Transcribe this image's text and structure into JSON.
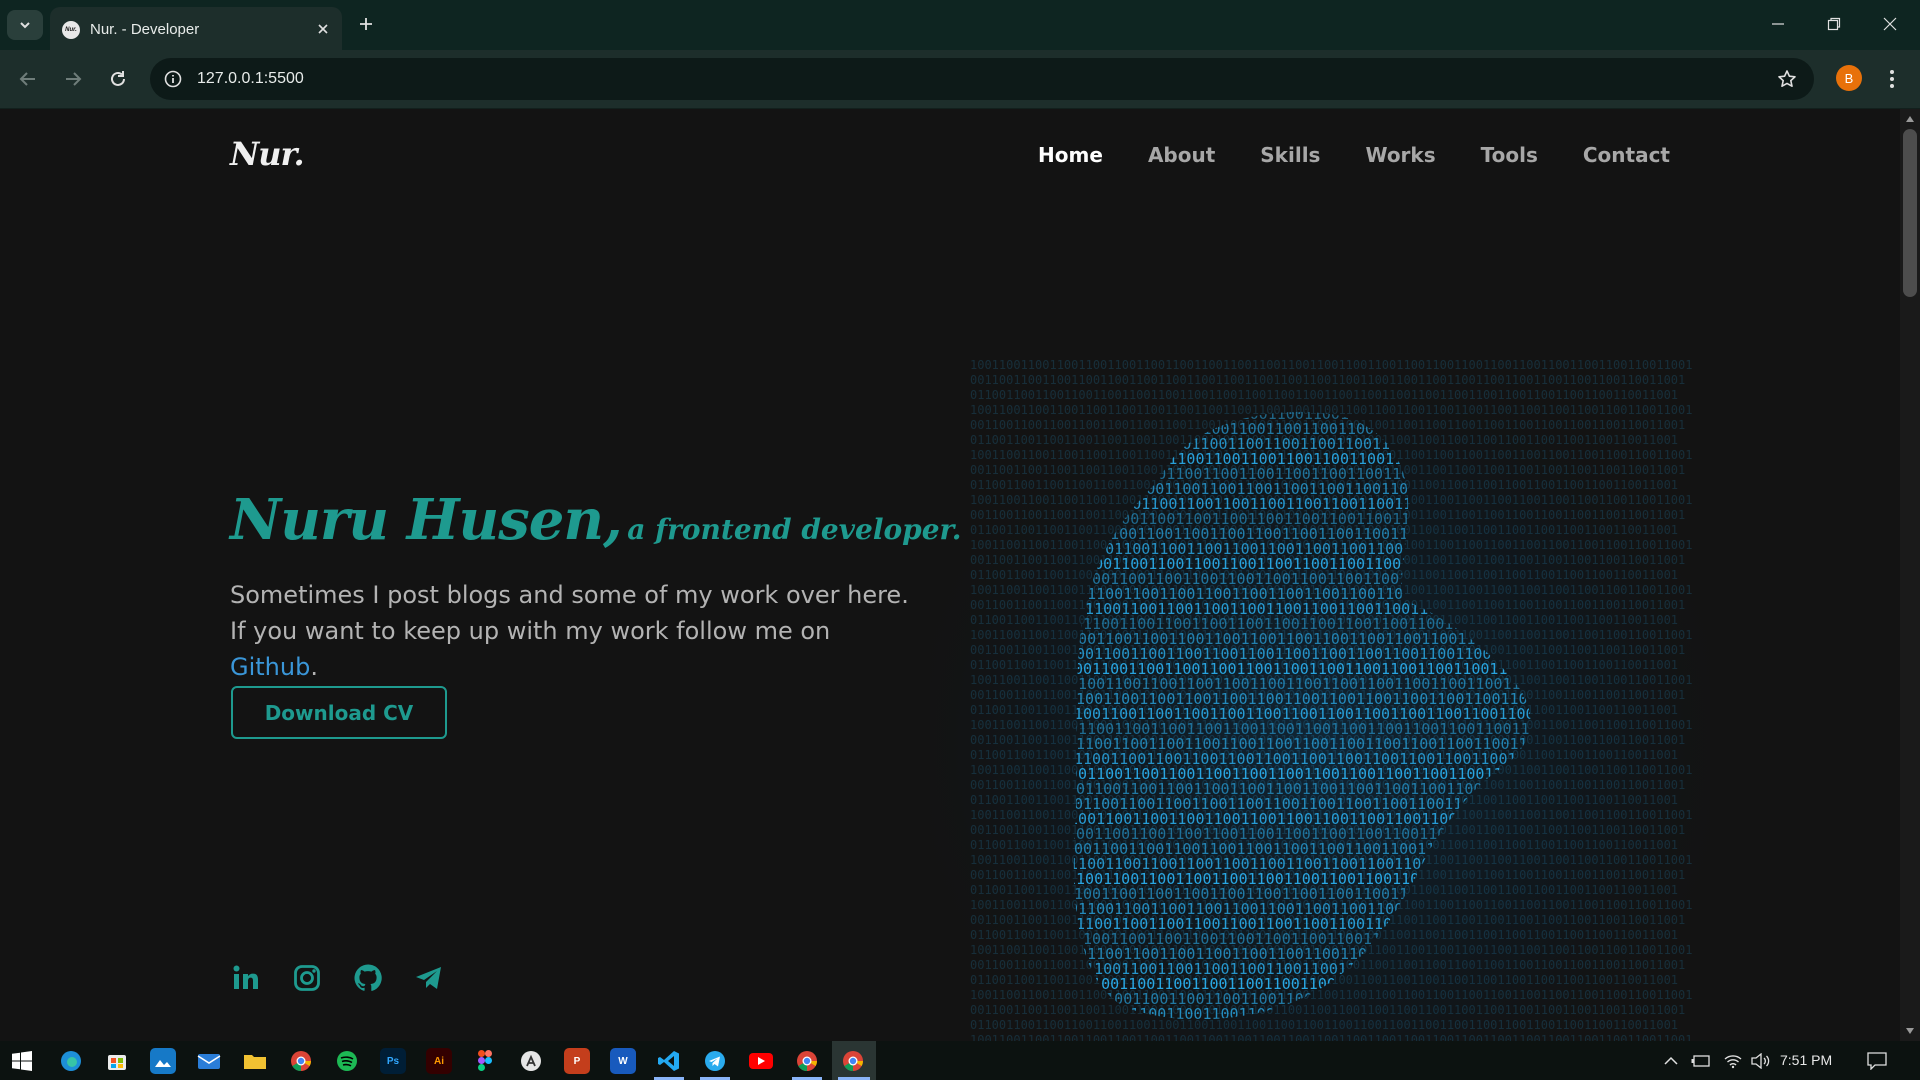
{
  "browser": {
    "tab_title": "Nur. - Developer",
    "tab_favicon_text": "Nur.",
    "url": "127.0.0.1:5500",
    "profile_initial": "B"
  },
  "site": {
    "logo": "Nur.",
    "nav": [
      {
        "label": "Home",
        "active": true
      },
      {
        "label": "About"
      },
      {
        "label": "Skills"
      },
      {
        "label": "Works"
      },
      {
        "label": "Tools"
      },
      {
        "label": "Contact"
      }
    ],
    "hero": {
      "name": "Nuru Husen,",
      "role": "a frontend developer.",
      "desc_before": "Sometimes I post blogs and some of my work over here. If you want to keep up with my work follow me on ",
      "desc_link": "Github",
      "desc_after": ".",
      "cv_button": "Download CV"
    },
    "socials": [
      "linkedin-icon",
      "instagram-icon",
      "github-icon",
      "telegram-icon"
    ],
    "binary_text": "10011001100110011001"
  },
  "taskbar": {
    "clock": "7:51 PM",
    "apps": [
      "edge",
      "store",
      "photos",
      "mail",
      "explorer",
      "chrome",
      "spotify",
      "Ps",
      "Ai",
      "figma",
      "appstore",
      "P",
      "W",
      "vscode",
      "telegram",
      "youtube",
      "chrome-profile",
      "chrome-active"
    ]
  },
  "colors": {
    "accent": "#1e9a8f",
    "link": "#3a96d8",
    "background": "#131313",
    "binary": "#2aa9e6"
  }
}
